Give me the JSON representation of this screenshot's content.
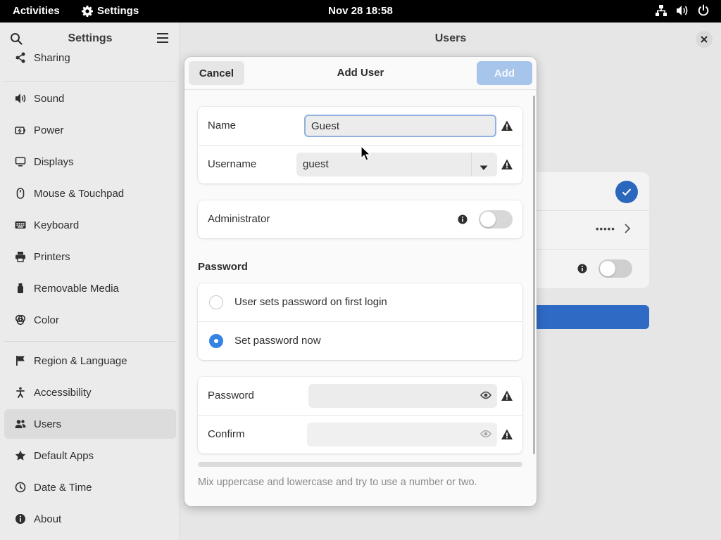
{
  "topbar": {
    "activities": "Activities",
    "app_name": "Settings",
    "clock": "Nov 28  18:58",
    "tray_icons": [
      "network-icon",
      "volume-icon",
      "power-icon"
    ]
  },
  "sidebar": {
    "title": "Settings",
    "items": [
      {
        "label": "Sharing",
        "icon": "share-icon"
      },
      {
        "label": "Sound",
        "icon": "speaker-icon"
      },
      {
        "label": "Power",
        "icon": "power-icon"
      },
      {
        "label": "Displays",
        "icon": "display-icon"
      },
      {
        "label": "Mouse & Touchpad",
        "icon": "mouse-icon"
      },
      {
        "label": "Keyboard",
        "icon": "keyboard-icon"
      },
      {
        "label": "Printers",
        "icon": "printer-icon"
      },
      {
        "label": "Removable Media",
        "icon": "usb-icon"
      },
      {
        "label": "Color",
        "icon": "palette-icon"
      },
      {
        "label": "Region & Language",
        "icon": "flag-icon"
      },
      {
        "label": "Accessibility",
        "icon": "accessibility-icon"
      },
      {
        "label": "Users",
        "icon": "users-icon",
        "active": true
      },
      {
        "label": "Default Apps",
        "icon": "star-icon"
      },
      {
        "label": "Date & Time",
        "icon": "clock-icon"
      },
      {
        "label": "About",
        "icon": "info-icon"
      }
    ]
  },
  "content": {
    "title": "Users",
    "background_dots": "•••••"
  },
  "dialog": {
    "title": "Add User",
    "cancel_label": "Cancel",
    "add_label": "Add",
    "name": {
      "label": "Name",
      "value": "Guest"
    },
    "username": {
      "label": "Username",
      "value": "guest"
    },
    "administrator": {
      "label": "Administrator",
      "enabled": false
    },
    "password_section": {
      "title": "Password",
      "options": [
        {
          "label": "User sets password on first login",
          "selected": false
        },
        {
          "label": "Set password now",
          "selected": true
        }
      ]
    },
    "password": {
      "label": "Password",
      "value": ""
    },
    "confirm": {
      "label": "Confirm",
      "value": ""
    },
    "strength_level": 0,
    "hint": "Mix uppercase and lowercase and try to use a number or two."
  },
  "colors": {
    "accent": "#3584e4",
    "add_button_disabled": "#a7c5ea",
    "background_button": "#2f6bc4"
  }
}
